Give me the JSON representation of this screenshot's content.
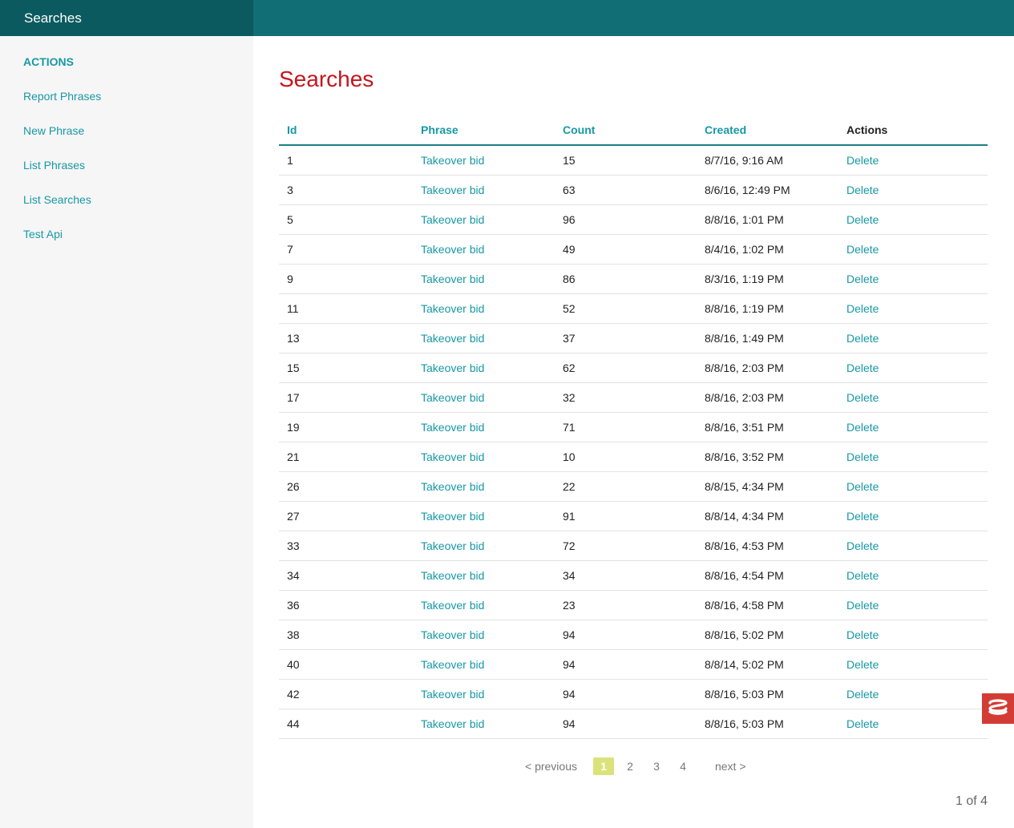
{
  "header": {
    "brand": "Searches"
  },
  "sidebar": {
    "heading": "ACTIONS",
    "items": [
      {
        "label": "Report Phrases"
      },
      {
        "label": "New Phrase"
      },
      {
        "label": "List Phrases"
      },
      {
        "label": "List Searches"
      },
      {
        "label": "Test Api"
      }
    ]
  },
  "main": {
    "title": "Searches",
    "columns": [
      "Id",
      "Phrase",
      "Count",
      "Created",
      "Actions"
    ],
    "rows": [
      {
        "id": "1",
        "phrase": "Takeover bid",
        "count": "15",
        "created": "8/7/16, 9:16 AM",
        "action": "Delete"
      },
      {
        "id": "3",
        "phrase": "Takeover bid",
        "count": "63",
        "created": "8/6/16, 12:49 PM",
        "action": "Delete"
      },
      {
        "id": "5",
        "phrase": "Takeover bid",
        "count": "96",
        "created": "8/8/16, 1:01 PM",
        "action": "Delete"
      },
      {
        "id": "7",
        "phrase": "Takeover bid",
        "count": "49",
        "created": "8/4/16, 1:02 PM",
        "action": "Delete"
      },
      {
        "id": "9",
        "phrase": "Takeover bid",
        "count": "86",
        "created": "8/3/16, 1:19 PM",
        "action": "Delete"
      },
      {
        "id": "11",
        "phrase": "Takeover bid",
        "count": "52",
        "created": "8/8/16, 1:19 PM",
        "action": "Delete"
      },
      {
        "id": "13",
        "phrase": "Takeover bid",
        "count": "37",
        "created": "8/8/16, 1:49 PM",
        "action": "Delete"
      },
      {
        "id": "15",
        "phrase": "Takeover bid",
        "count": "62",
        "created": "8/8/16, 2:03 PM",
        "action": "Delete"
      },
      {
        "id": "17",
        "phrase": "Takeover bid",
        "count": "32",
        "created": "8/8/16, 2:03 PM",
        "action": "Delete"
      },
      {
        "id": "19",
        "phrase": "Takeover bid",
        "count": "71",
        "created": "8/8/16, 3:51 PM",
        "action": "Delete"
      },
      {
        "id": "21",
        "phrase": "Takeover bid",
        "count": "10",
        "created": "8/8/16, 3:52 PM",
        "action": "Delete"
      },
      {
        "id": "26",
        "phrase": "Takeover bid",
        "count": "22",
        "created": "8/8/15, 4:34 PM",
        "action": "Delete"
      },
      {
        "id": "27",
        "phrase": "Takeover bid",
        "count": "91",
        "created": "8/8/14, 4:34 PM",
        "action": "Delete"
      },
      {
        "id": "33",
        "phrase": "Takeover bid",
        "count": "72",
        "created": "8/8/16, 4:53 PM",
        "action": "Delete"
      },
      {
        "id": "34",
        "phrase": "Takeover bid",
        "count": "34",
        "created": "8/8/16, 4:54 PM",
        "action": "Delete"
      },
      {
        "id": "36",
        "phrase": "Takeover bid",
        "count": "23",
        "created": "8/8/16, 4:58 PM",
        "action": "Delete"
      },
      {
        "id": "38",
        "phrase": "Takeover bid",
        "count": "94",
        "created": "8/8/16, 5:02 PM",
        "action": "Delete"
      },
      {
        "id": "40",
        "phrase": "Takeover bid",
        "count": "94",
        "created": "8/8/14, 5:02 PM",
        "action": "Delete"
      },
      {
        "id": "42",
        "phrase": "Takeover bid",
        "count": "94",
        "created": "8/8/16, 5:03 PM",
        "action": "Delete"
      },
      {
        "id": "44",
        "phrase": "Takeover bid",
        "count": "94",
        "created": "8/8/16, 5:03 PM",
        "action": "Delete"
      }
    ]
  },
  "pagination": {
    "previous": "< previous",
    "pages": [
      "1",
      "2",
      "3",
      "4"
    ],
    "current": "1",
    "next": "next >",
    "counter": "1 of 4"
  },
  "widget": {
    "icon": "cakephp-debug-icon"
  },
  "colors": {
    "header_bg": "#116e74",
    "brand_bg": "#0b5a5f",
    "link": "#1798a5",
    "title": "#c4161c",
    "active_page": "#dbe27a",
    "widget": "#d33c35"
  }
}
